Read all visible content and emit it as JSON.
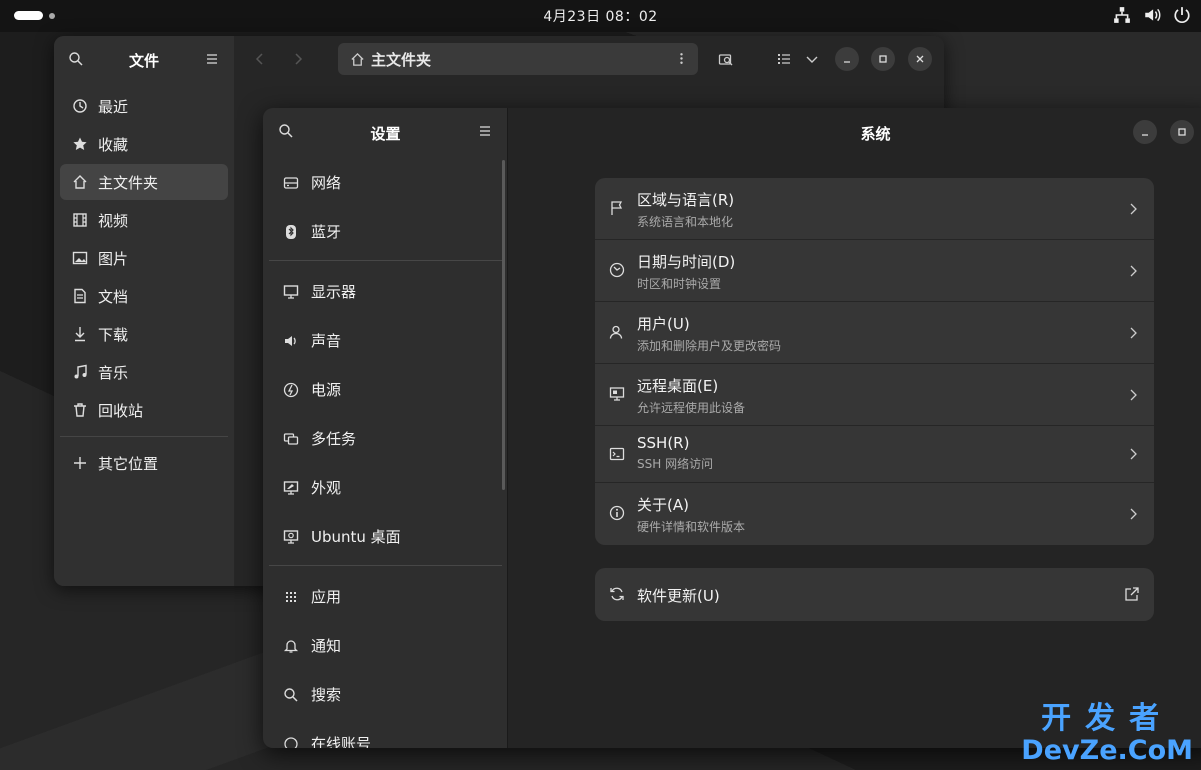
{
  "topbar": {
    "clock": "4月23日  08：02",
    "icons": [
      "network-icon",
      "volume-icon",
      "power-icon"
    ]
  },
  "files": {
    "sidebar_title": "文件",
    "path": "主文件夹",
    "nav": [
      {
        "label": "最近",
        "icon": "clock-icon"
      },
      {
        "label": "收藏",
        "icon": "star-icon"
      },
      {
        "label": "主文件夹",
        "icon": "home-icon",
        "active": true
      },
      {
        "label": "视频",
        "icon": "film-icon"
      },
      {
        "label": "图片",
        "icon": "image-icon"
      },
      {
        "label": "文档",
        "icon": "document-icon"
      },
      {
        "label": "下载",
        "icon": "download-icon"
      },
      {
        "label": "音乐",
        "icon": "music-icon"
      },
      {
        "label": "回收站",
        "icon": "trash-icon"
      }
    ],
    "other_places": "其它位置"
  },
  "settings": {
    "sidebar_title": "设置",
    "page_title": "系统",
    "nav_group1": [
      {
        "label": "网络",
        "icon": "network-icon"
      },
      {
        "label": "蓝牙",
        "icon": "bluetooth-icon"
      }
    ],
    "nav_group2": [
      {
        "label": "显示器",
        "icon": "display-icon"
      },
      {
        "label": "声音",
        "icon": "sound-icon"
      },
      {
        "label": "电源",
        "icon": "power-icon"
      },
      {
        "label": "多任务",
        "icon": "multitask-icon"
      },
      {
        "label": "外观",
        "icon": "appearance-icon"
      },
      {
        "label": "Ubuntu 桌面",
        "icon": "ubuntu-desktop-icon"
      }
    ],
    "nav_group3": [
      {
        "label": "应用",
        "icon": "apps-icon"
      },
      {
        "label": "通知",
        "icon": "bell-icon"
      },
      {
        "label": "搜索",
        "icon": "search-icon"
      },
      {
        "label": "在线账号",
        "icon": "accounts-icon"
      }
    ],
    "rows": [
      {
        "title": "区域与语言(R)",
        "subtitle": "系统语言和本地化",
        "icon": "flag-icon"
      },
      {
        "title": "日期与时间(D)",
        "subtitle": "时区和时钟设置",
        "icon": "clock-icon"
      },
      {
        "title": "用户(U)",
        "subtitle": "添加和删除用户及更改密码",
        "icon": "users-icon"
      },
      {
        "title": "远程桌面(E)",
        "subtitle": "允许远程使用此设备",
        "icon": "remote-desktop-icon"
      },
      {
        "title": "SSH(R)",
        "subtitle": "SSH 网络访问",
        "icon": "terminal-icon"
      },
      {
        "title": "关于(A)",
        "subtitle": "硬件详情和软件版本",
        "icon": "info-icon"
      }
    ],
    "update_row": {
      "title": "软件更新(U)",
      "icon": "refresh-icon"
    }
  },
  "watermark": {
    "line1": "开发者",
    "line2": "DevZe.CoM"
  }
}
